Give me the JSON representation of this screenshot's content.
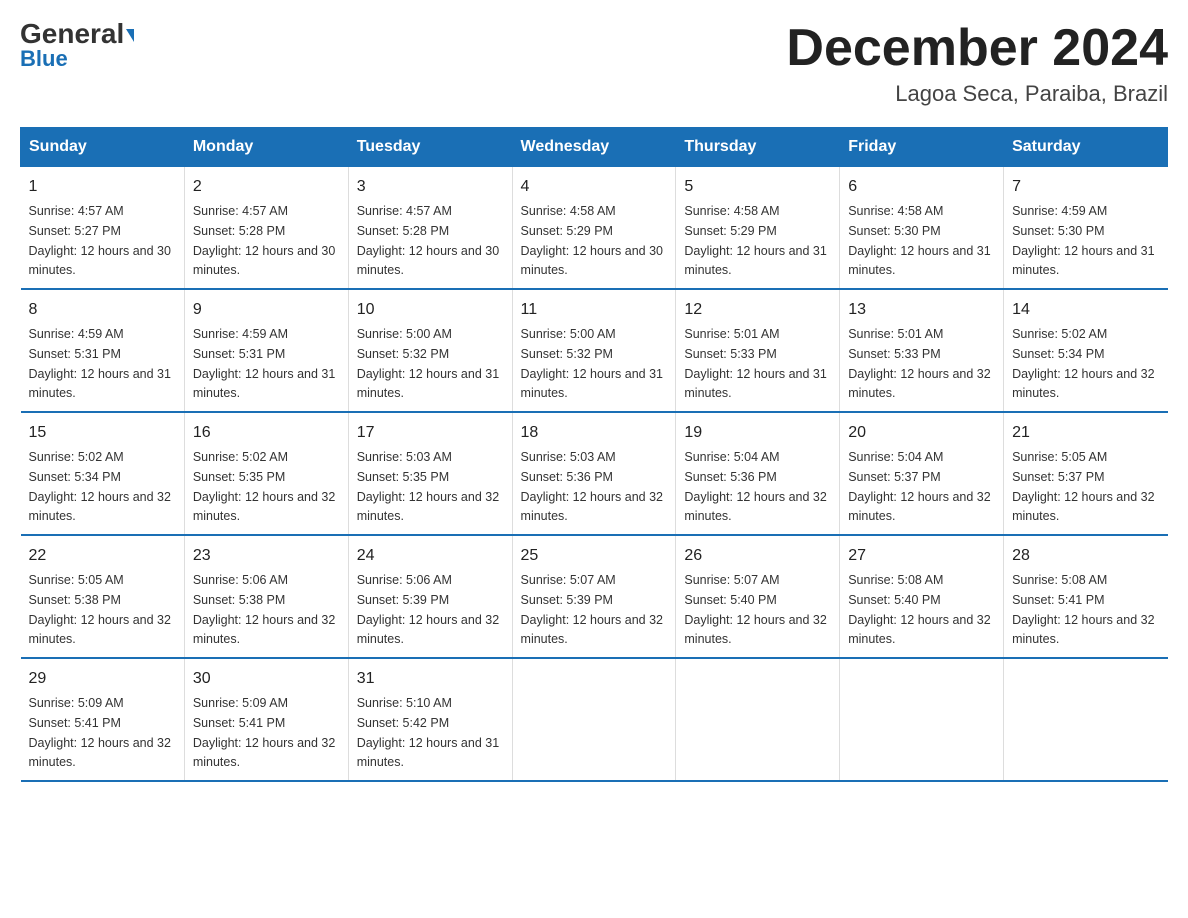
{
  "logo": {
    "general": "General",
    "blue": "Blue"
  },
  "title": "December 2024",
  "subtitle": "Lagoa Seca, Paraiba, Brazil",
  "days_of_week": [
    "Sunday",
    "Monday",
    "Tuesday",
    "Wednesday",
    "Thursday",
    "Friday",
    "Saturday"
  ],
  "weeks": [
    [
      {
        "date": "1",
        "sunrise": "4:57 AM",
        "sunset": "5:27 PM",
        "daylight": "12 hours and 30 minutes."
      },
      {
        "date": "2",
        "sunrise": "4:57 AM",
        "sunset": "5:28 PM",
        "daylight": "12 hours and 30 minutes."
      },
      {
        "date": "3",
        "sunrise": "4:57 AM",
        "sunset": "5:28 PM",
        "daylight": "12 hours and 30 minutes."
      },
      {
        "date": "4",
        "sunrise": "4:58 AM",
        "sunset": "5:29 PM",
        "daylight": "12 hours and 30 minutes."
      },
      {
        "date": "5",
        "sunrise": "4:58 AM",
        "sunset": "5:29 PM",
        "daylight": "12 hours and 31 minutes."
      },
      {
        "date": "6",
        "sunrise": "4:58 AM",
        "sunset": "5:30 PM",
        "daylight": "12 hours and 31 minutes."
      },
      {
        "date": "7",
        "sunrise": "4:59 AM",
        "sunset": "5:30 PM",
        "daylight": "12 hours and 31 minutes."
      }
    ],
    [
      {
        "date": "8",
        "sunrise": "4:59 AM",
        "sunset": "5:31 PM",
        "daylight": "12 hours and 31 minutes."
      },
      {
        "date": "9",
        "sunrise": "4:59 AM",
        "sunset": "5:31 PM",
        "daylight": "12 hours and 31 minutes."
      },
      {
        "date": "10",
        "sunrise": "5:00 AM",
        "sunset": "5:32 PM",
        "daylight": "12 hours and 31 minutes."
      },
      {
        "date": "11",
        "sunrise": "5:00 AM",
        "sunset": "5:32 PM",
        "daylight": "12 hours and 31 minutes."
      },
      {
        "date": "12",
        "sunrise": "5:01 AM",
        "sunset": "5:33 PM",
        "daylight": "12 hours and 31 minutes."
      },
      {
        "date": "13",
        "sunrise": "5:01 AM",
        "sunset": "5:33 PM",
        "daylight": "12 hours and 32 minutes."
      },
      {
        "date": "14",
        "sunrise": "5:02 AM",
        "sunset": "5:34 PM",
        "daylight": "12 hours and 32 minutes."
      }
    ],
    [
      {
        "date": "15",
        "sunrise": "5:02 AM",
        "sunset": "5:34 PM",
        "daylight": "12 hours and 32 minutes."
      },
      {
        "date": "16",
        "sunrise": "5:02 AM",
        "sunset": "5:35 PM",
        "daylight": "12 hours and 32 minutes."
      },
      {
        "date": "17",
        "sunrise": "5:03 AM",
        "sunset": "5:35 PM",
        "daylight": "12 hours and 32 minutes."
      },
      {
        "date": "18",
        "sunrise": "5:03 AM",
        "sunset": "5:36 PM",
        "daylight": "12 hours and 32 minutes."
      },
      {
        "date": "19",
        "sunrise": "5:04 AM",
        "sunset": "5:36 PM",
        "daylight": "12 hours and 32 minutes."
      },
      {
        "date": "20",
        "sunrise": "5:04 AM",
        "sunset": "5:37 PM",
        "daylight": "12 hours and 32 minutes."
      },
      {
        "date": "21",
        "sunrise": "5:05 AM",
        "sunset": "5:37 PM",
        "daylight": "12 hours and 32 minutes."
      }
    ],
    [
      {
        "date": "22",
        "sunrise": "5:05 AM",
        "sunset": "5:38 PM",
        "daylight": "12 hours and 32 minutes."
      },
      {
        "date": "23",
        "sunrise": "5:06 AM",
        "sunset": "5:38 PM",
        "daylight": "12 hours and 32 minutes."
      },
      {
        "date": "24",
        "sunrise": "5:06 AM",
        "sunset": "5:39 PM",
        "daylight": "12 hours and 32 minutes."
      },
      {
        "date": "25",
        "sunrise": "5:07 AM",
        "sunset": "5:39 PM",
        "daylight": "12 hours and 32 minutes."
      },
      {
        "date": "26",
        "sunrise": "5:07 AM",
        "sunset": "5:40 PM",
        "daylight": "12 hours and 32 minutes."
      },
      {
        "date": "27",
        "sunrise": "5:08 AM",
        "sunset": "5:40 PM",
        "daylight": "12 hours and 32 minutes."
      },
      {
        "date": "28",
        "sunrise": "5:08 AM",
        "sunset": "5:41 PM",
        "daylight": "12 hours and 32 minutes."
      }
    ],
    [
      {
        "date": "29",
        "sunrise": "5:09 AM",
        "sunset": "5:41 PM",
        "daylight": "12 hours and 32 minutes."
      },
      {
        "date": "30",
        "sunrise": "5:09 AM",
        "sunset": "5:41 PM",
        "daylight": "12 hours and 32 minutes."
      },
      {
        "date": "31",
        "sunrise": "5:10 AM",
        "sunset": "5:42 PM",
        "daylight": "12 hours and 31 minutes."
      },
      null,
      null,
      null,
      null
    ]
  ],
  "labels": {
    "sunrise": "Sunrise:",
    "sunset": "Sunset:",
    "daylight": "Daylight:"
  },
  "colors": {
    "header_bg": "#1a6fb5",
    "header_text": "#ffffff",
    "border": "#1a6fb5"
  }
}
